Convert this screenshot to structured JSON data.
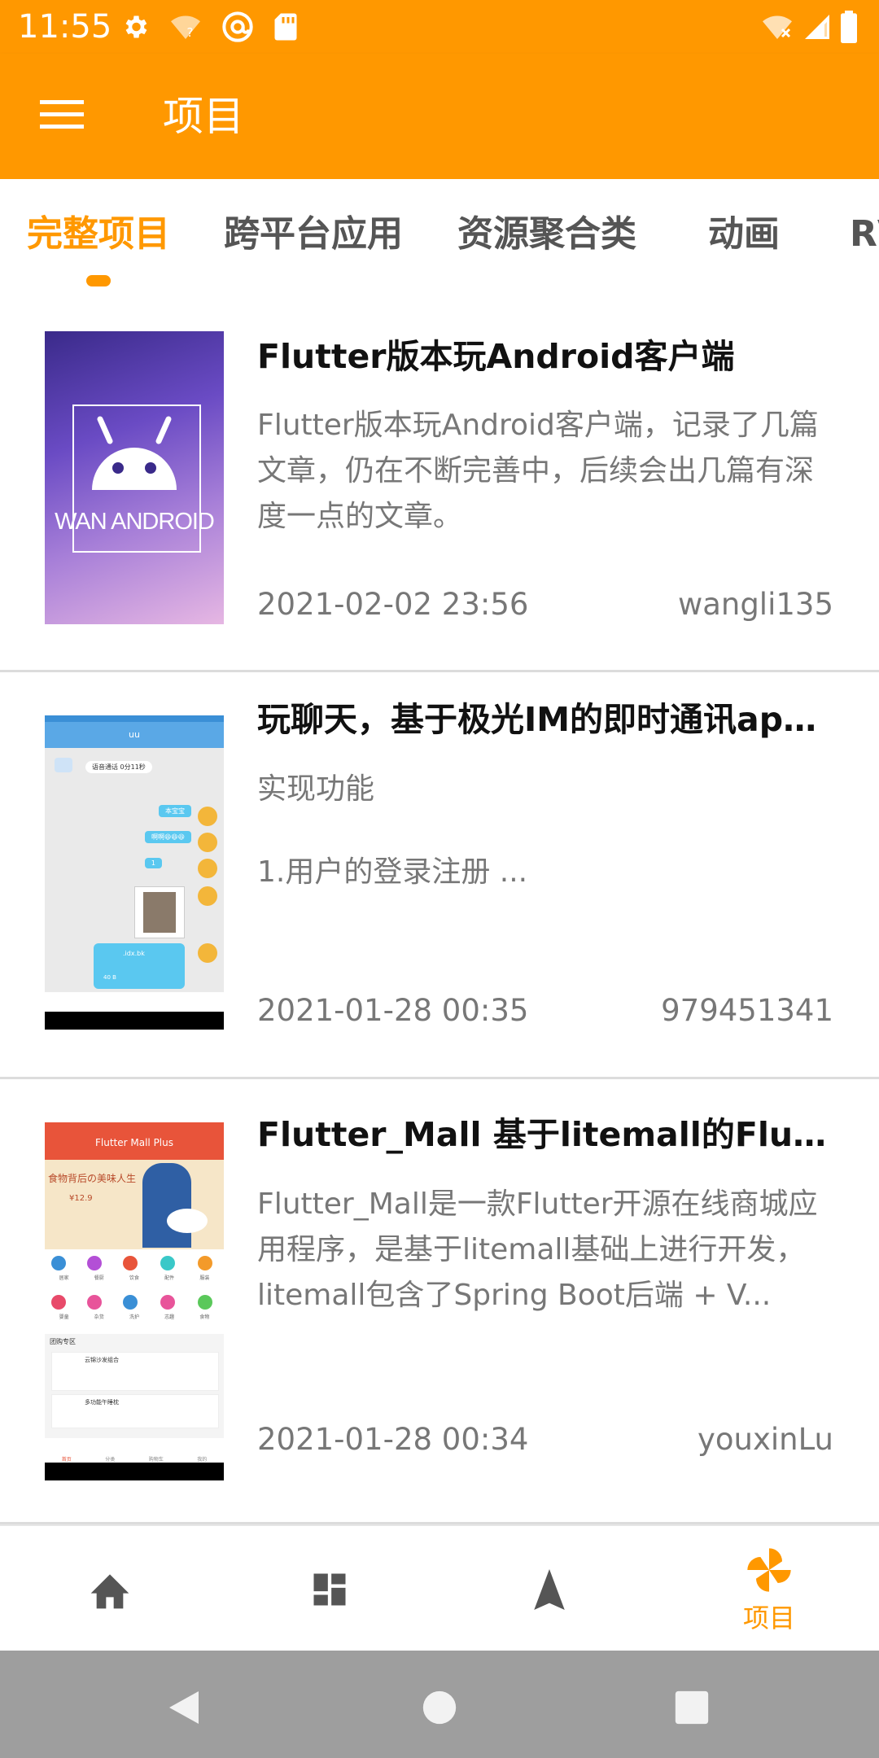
{
  "status_bar": {
    "time": "11:55",
    "left_icons": [
      "gear-icon",
      "wifi-question-icon",
      "at-sign-icon",
      "sd-card-icon"
    ],
    "right_icons": [
      "wifi-off-icon",
      "signal-icon",
      "battery-icon"
    ]
  },
  "app_bar": {
    "title": "项目",
    "menu_icon": "menu-icon"
  },
  "tabs": [
    {
      "label": "完整项目",
      "active": true
    },
    {
      "label": "跨平台应用",
      "active": false
    },
    {
      "label": "资源聚合类",
      "active": false
    },
    {
      "label": "动画",
      "active": false
    },
    {
      "label": "RV",
      "active": false
    }
  ],
  "accent_color": "#ff9800",
  "items": [
    {
      "title": "Flutter版本玩Android客户端",
      "desc": "Flutter版本玩Android客户端，记录了几篇文章，仍在不断完善中，后续会出几篇有深度一点的文章。",
      "date": "2021-02-02 23:56",
      "author": "wangli135",
      "thumb_text": "WAN ANDROID"
    },
    {
      "title": "玩聊天，基于极光IM的即时通讯app...",
      "desc_line1": "实现功能",
      "desc_line2": "1.用户的登录注册 ...",
      "date": "2021-01-28 00:35",
      "author": "979451341",
      "thumb": {
        "header": "uu",
        "voice_msg": "语音通话 0分11秒",
        "msgs": [
          "本宝宝",
          "啊啊😆😆😆",
          "1"
        ],
        "file": ".idx.bk",
        "file_size": "40 B"
      }
    },
    {
      "title": "Flutter_Mall 基于litemall的Flutter...",
      "desc": "Flutter_Mall是一款Flutter开源在线商城应用程序，是基于litemall基础上进行开发，litemall包含了Spring Boot后端 + V...",
      "date": "2021-01-28 00:34",
      "author": "youxinLu",
      "thumb": {
        "header": "Flutter Mall Plus",
        "banner": "食物背后の美味人生",
        "price": "¥12.9",
        "categories": [
          "居家",
          "餐厨",
          "饮食",
          "配件",
          "服装",
          "婴童",
          "杂货",
          "洗护",
          "志趣",
          "食物"
        ],
        "section": "团购专区",
        "product1": "云锦沙发组合",
        "product2": "多功能午睡枕",
        "tabs": [
          "首页",
          "分类",
          "购物车",
          "我的"
        ]
      }
    }
  ],
  "bottom_nav": [
    {
      "icon": "home-icon",
      "label": ""
    },
    {
      "icon": "dashboard-icon",
      "label": ""
    },
    {
      "icon": "navigation-icon",
      "label": ""
    },
    {
      "icon": "pinwheel-icon",
      "label": "项目",
      "active": true
    }
  ],
  "system_nav": [
    "back-icon",
    "home-circle-icon",
    "recents-icon"
  ]
}
